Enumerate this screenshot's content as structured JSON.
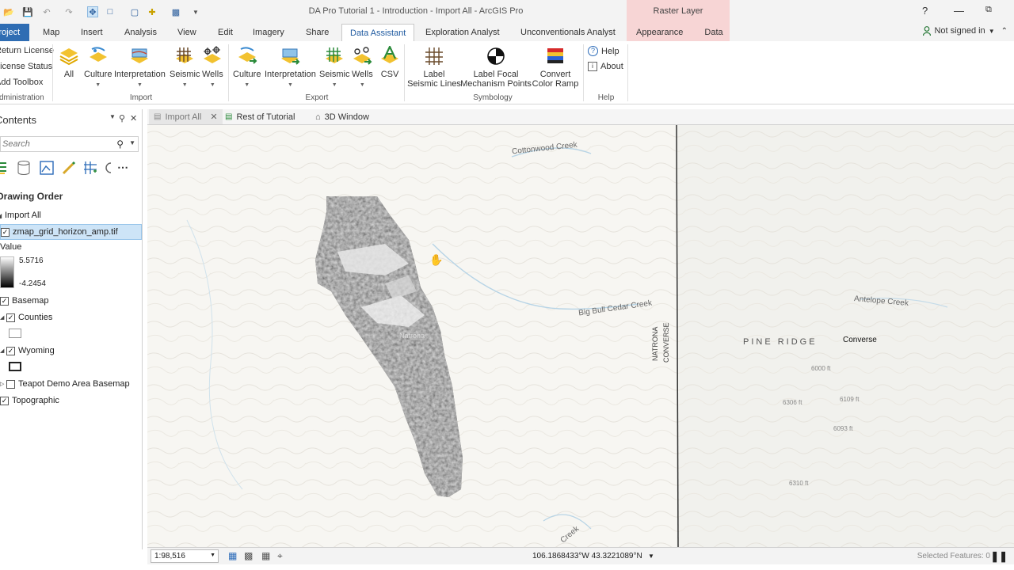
{
  "window": {
    "title": "DA Pro Tutorial 1 - Introduction - Import All - ArcGIS Pro",
    "context_tab_group": "Raster Layer",
    "help": "?"
  },
  "tabs": [
    {
      "label": "Project"
    },
    {
      "label": "Map"
    },
    {
      "label": "Insert"
    },
    {
      "label": "Analysis"
    },
    {
      "label": "View"
    },
    {
      "label": "Edit"
    },
    {
      "label": "Imagery"
    },
    {
      "label": "Share"
    },
    {
      "label": "Data Assistant"
    },
    {
      "label": "Exploration Analyst"
    },
    {
      "label": "Unconventionals Analyst"
    },
    {
      "label": "Appearance"
    },
    {
      "label": "Data"
    }
  ],
  "signin": {
    "label": "Not signed in"
  },
  "ribbon": {
    "project_cmds": [
      "Return License",
      "License Status",
      "Add Toolbox"
    ],
    "project_group": "Administration",
    "import_items": [
      "All",
      "Culture",
      "Interpretation",
      "Seismic",
      "Wells"
    ],
    "import_group": "Import",
    "export_items": [
      "Culture",
      "Interpretation",
      "Seismic",
      "Wells",
      "CSV"
    ],
    "export_group": "Export",
    "symbology_items": [
      "Label\nSeismic Lines",
      "Label Focal\nMechanism Points",
      "Convert\nColor Ramp"
    ],
    "symbology_labels": {
      "a1": "Label",
      "a2": "Seismic Lines",
      "b1": "Label Focal",
      "b2": "Mechanism Points",
      "c1": "Convert",
      "c2": "Color Ramp"
    },
    "symbology_group": "Symbology",
    "help_items": [
      "Help",
      "About"
    ],
    "help_group": "Help"
  },
  "contents": {
    "title": "Contents",
    "search_placeholder": "Search",
    "drawing_order": "Drawing Order",
    "map_name": "Import All",
    "layers": {
      "raster": "zmap_grid_horizon_amp.tif",
      "value_label": "Value",
      "value_max": "5.5716",
      "value_min": "-4.2454",
      "basemap": "Basemap",
      "counties": "Counties",
      "wyoming": "Wyoming",
      "teapot": "Teapot Demo Area Basemap",
      "topographic": "Topographic"
    }
  },
  "view_tabs": [
    {
      "label": "Import All"
    },
    {
      "label": "Rest of Tutorial"
    },
    {
      "label": "3D Window"
    }
  ],
  "map": {
    "labels": {
      "cottonwood": "Cottonwood Creek",
      "bigbull": "Big Bull Cedar Creek",
      "antelope": "Antelope Creek",
      "pine_ridge": "PINE RIDGE",
      "converse_label": "Converse",
      "natrona_label": "Natrona",
      "natrona_vertical": "NATRONA",
      "converse_vertical": "CONVERSE",
      "creek_bottom": "Creek"
    },
    "elevations": {
      "e1": "6306 ft",
      "e2": "6109 ft",
      "e3": "6310 ft",
      "e4": "6093 ft",
      "e5": "6000 ft"
    }
  },
  "status": {
    "scale": "1:98,516",
    "coordinates": "106.1868433°W 43.3221089°N",
    "selected_features": "Selected Features: 0"
  }
}
